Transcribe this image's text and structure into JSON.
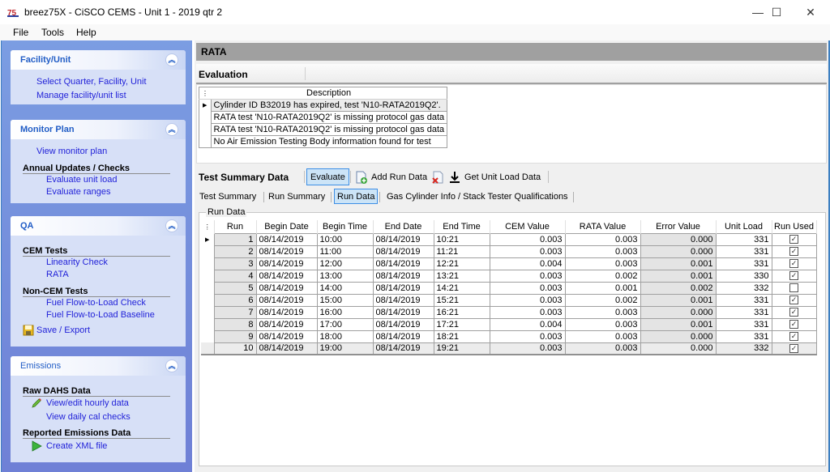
{
  "window": {
    "title": "breez75X - CiSCO CEMS - Unit 1 - 2019 qtr 2",
    "minimize": "—",
    "maximize": "☐",
    "close": "✕"
  },
  "menu": [
    "File",
    "Tools",
    "Help"
  ],
  "sidebar": {
    "facility": {
      "title": "Facility/Unit",
      "links": [
        "Select Quarter, Facility, Unit",
        "Manage facility/unit list"
      ]
    },
    "monitor": {
      "title": "Monitor Plan",
      "links": [
        "View monitor plan"
      ],
      "annual_head": "Annual Updates / Checks",
      "annual_links": [
        "Evaluate unit load",
        "Evaluate ranges"
      ]
    },
    "qa": {
      "title": "QA",
      "cem_head": "CEM Tests",
      "cem_links": [
        "Linearity Check",
        "RATA"
      ],
      "noncem_head": "Non-CEM Tests",
      "noncem_links": [
        "Fuel Flow-to-Load Check",
        "Fuel Flow-to-Load Baseline"
      ],
      "save": "Save / Export"
    },
    "emissions": {
      "title": "Emissions",
      "raw_head": "Raw DAHS Data",
      "raw_links": [
        "View/edit hourly data",
        "View daily cal checks"
      ],
      "rep_head": "Reported Emissions Data",
      "rep_links": [
        "Create XML file"
      ]
    },
    "collapse_glyph": "︽"
  },
  "main": {
    "title": "RATA",
    "evaluation": {
      "label": "Evaluation",
      "column": "Description",
      "rows": [
        "Cylinder ID B32019 has expired, test 'N10-RATA2019Q2'.",
        "RATA test 'N10-RATA2019Q2' is missing protocol gas data",
        "RATA test 'N10-RATA2019Q2' is missing protocol gas data",
        "No Air Emission Testing Body information found for test"
      ]
    },
    "toolbar": {
      "title": "Test Summary Data",
      "evaluate": "Evaluate",
      "add_run": "Add Run Data",
      "get_load": "Get Unit Load Data"
    },
    "tabs": [
      "Test Summary",
      "Run Summary",
      "Run Data",
      "Gas Cylinder Info / Stack Tester Qualifications"
    ],
    "active_tab": "Run Data",
    "run_data": {
      "label": "Run Data",
      "columns": [
        "Run",
        "Begin Date",
        "Begin Time",
        "End Date",
        "End Time",
        "CEM Value",
        "RATA Value",
        "Error Value",
        "Unit Load",
        "Run Used"
      ],
      "rows": [
        {
          "run": "1",
          "begin_date": "08/14/2019",
          "begin_time": "10:00",
          "end_date": "08/14/2019",
          "end_time": "10:21",
          "cem": "0.003",
          "rata": "0.003",
          "error": "0.000",
          "load": "331",
          "used": true
        },
        {
          "run": "2",
          "begin_date": "08/14/2019",
          "begin_time": "11:00",
          "end_date": "08/14/2019",
          "end_time": "11:21",
          "cem": "0.003",
          "rata": "0.003",
          "error": "0.000",
          "load": "331",
          "used": true
        },
        {
          "run": "3",
          "begin_date": "08/14/2019",
          "begin_time": "12:00",
          "end_date": "08/14/2019",
          "end_time": "12:21",
          "cem": "0.004",
          "rata": "0.003",
          "error": "0.001",
          "load": "331",
          "used": true
        },
        {
          "run": "4",
          "begin_date": "08/14/2019",
          "begin_time": "13:00",
          "end_date": "08/14/2019",
          "end_time": "13:21",
          "cem": "0.003",
          "rata": "0.002",
          "error": "0.001",
          "load": "330",
          "used": true
        },
        {
          "run": "5",
          "begin_date": "08/14/2019",
          "begin_time": "14:00",
          "end_date": "08/14/2019",
          "end_time": "14:21",
          "cem": "0.003",
          "rata": "0.001",
          "error": "0.002",
          "load": "332",
          "used": false
        },
        {
          "run": "6",
          "begin_date": "08/14/2019",
          "begin_time": "15:00",
          "end_date": "08/14/2019",
          "end_time": "15:21",
          "cem": "0.003",
          "rata": "0.002",
          "error": "0.001",
          "load": "331",
          "used": true
        },
        {
          "run": "7",
          "begin_date": "08/14/2019",
          "begin_time": "16:00",
          "end_date": "08/14/2019",
          "end_time": "16:21",
          "cem": "0.003",
          "rata": "0.003",
          "error": "0.000",
          "load": "331",
          "used": true
        },
        {
          "run": "8",
          "begin_date": "08/14/2019",
          "begin_time": "17:00",
          "end_date": "08/14/2019",
          "end_time": "17:21",
          "cem": "0.004",
          "rata": "0.003",
          "error": "0.001",
          "load": "331",
          "used": true
        },
        {
          "run": "9",
          "begin_date": "08/14/2019",
          "begin_time": "18:00",
          "end_date": "08/14/2019",
          "end_time": "18:21",
          "cem": "0.003",
          "rata": "0.003",
          "error": "0.000",
          "load": "331",
          "used": true
        },
        {
          "run": "10",
          "begin_date": "08/14/2019",
          "begin_time": "19:00",
          "end_date": "08/14/2019",
          "end_time": "19:21",
          "cem": "0.003",
          "rata": "0.003",
          "error": "0.000",
          "load": "332",
          "used": true
        }
      ]
    }
  }
}
